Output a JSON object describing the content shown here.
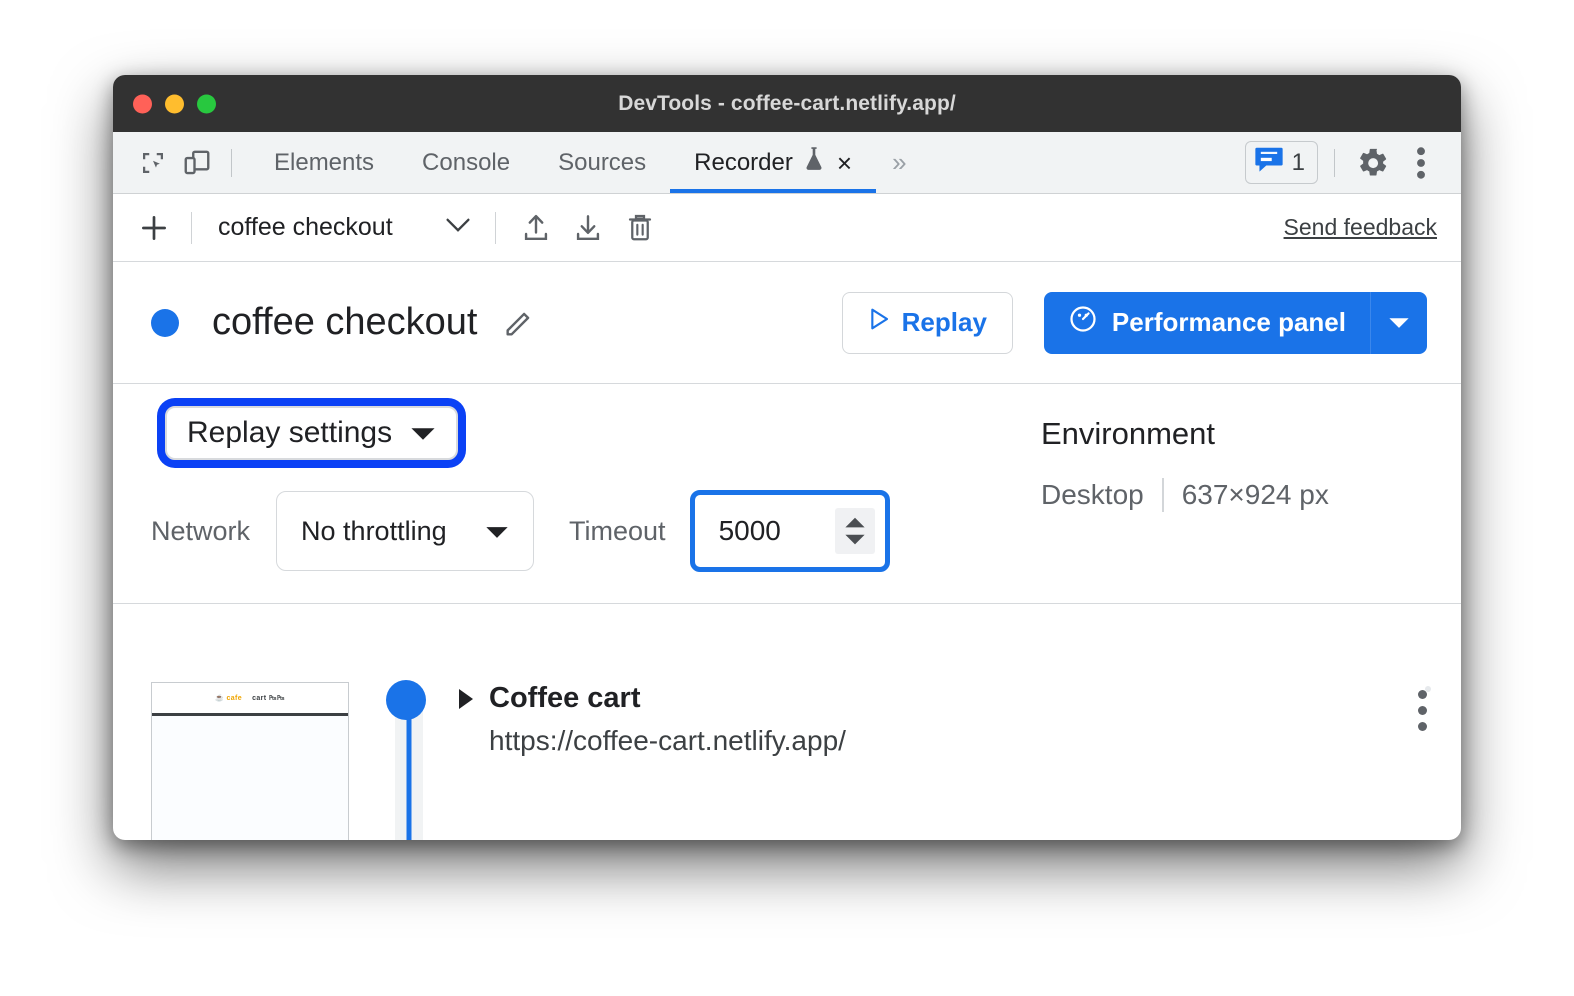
{
  "window": {
    "title": "DevTools - coffee-cart.netlify.app/",
    "controls": [
      "close",
      "minimize",
      "maximize"
    ]
  },
  "tabstrip": {
    "inspect_icon": "inspect-element-icon",
    "device_icon": "device-toolbar-icon",
    "tabs": [
      {
        "label": "Elements",
        "active": false
      },
      {
        "label": "Console",
        "active": false
      },
      {
        "label": "Sources",
        "active": false
      },
      {
        "label": "Recorder",
        "active": true,
        "experimental_icon": "flask-icon",
        "closable": true
      }
    ],
    "more_tabs": "»",
    "issues": {
      "icon": "issues-speech-bubble-icon",
      "count": "1"
    },
    "settings_icon": "gear-icon",
    "menu_icon": "kebab-menu-icon",
    "close_label": "×"
  },
  "recorder_toolbar": {
    "add_label": "+",
    "recording_name": "coffee checkout",
    "dropdown_icon": "chevron-down-icon",
    "export_icon": "upload-icon",
    "import_icon": "download-icon",
    "delete_icon": "trash-icon",
    "feedback_label": "Send feedback"
  },
  "title_row": {
    "status_dot": "recording-status-dot",
    "title": "coffee checkout",
    "edit_icon": "pencil-icon",
    "replay": {
      "label": "Replay",
      "icon": "play-triangle-icon"
    },
    "performance": {
      "label": "Performance panel",
      "icon": "performance-gauge-icon",
      "dropdown_icon": "chevron-down-icon"
    }
  },
  "settings": {
    "toggle_label": "Replay settings",
    "toggle_icon": "caret-down-icon",
    "highlight_color": "#0b41f5",
    "network": {
      "label": "Network",
      "value": "No throttling",
      "icon": "caret-down-icon"
    },
    "timeout": {
      "label": "Timeout",
      "value": "5000",
      "spinner_icon": "number-spinner-icon",
      "highlight_color": "#1a73e8"
    },
    "environment": {
      "heading": "Environment",
      "device": "Desktop",
      "viewport": "637×924 px"
    }
  },
  "steps": [
    {
      "title": "Coffee cart",
      "url": "https://coffee-cart.netlify.app/",
      "caret_icon": "expand-caret-icon",
      "menu_icon": "kebab-menu-icon",
      "thumbnail": {
        "logo": "☕ cafe",
        "heading": "cart ₧₧"
      }
    }
  ],
  "colors": {
    "accent_blue": "#1a73e8",
    "highlight_blue": "#0b41f5",
    "titlebar": "#323232",
    "tabstrip": "#f1f3f4"
  }
}
